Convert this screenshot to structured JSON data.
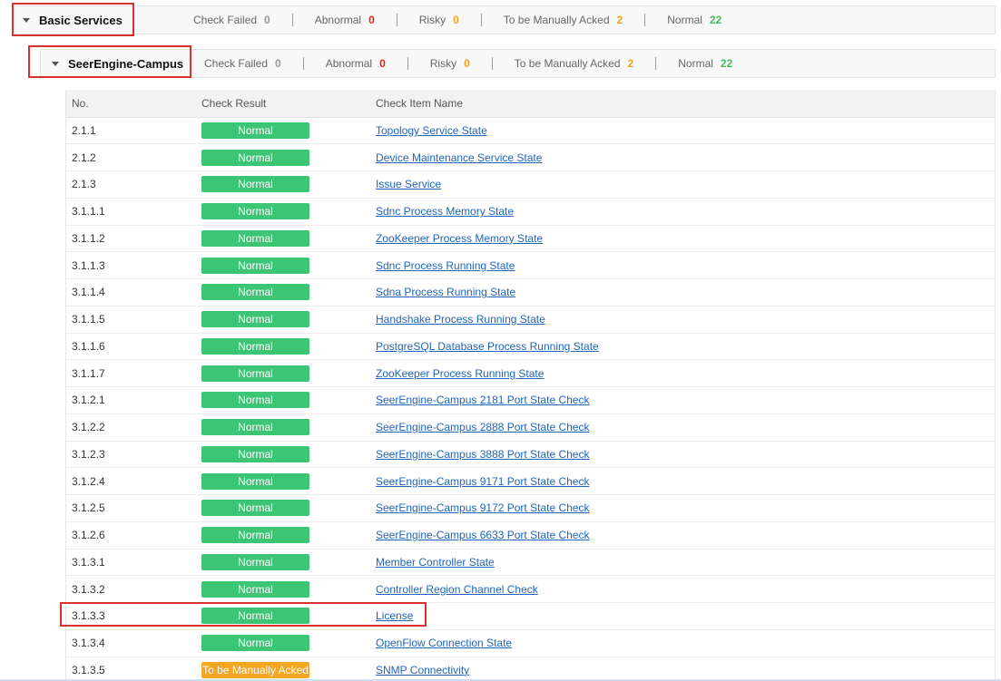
{
  "colors": {
    "normal_badge": "#3cc574",
    "ack_badge": "#f5a623",
    "link": "#2165bb",
    "highlight": "#d9312b",
    "failed": "#999999",
    "abnormal": "#e02020",
    "risky": "#f3a31b",
    "ack": "#f3a31b",
    "normal": "#3fbf5c"
  },
  "icons": {
    "expand": "caret-down-icon"
  },
  "group1": {
    "title": "Basic Services",
    "stats": [
      {
        "label": "Check Failed",
        "value": "0",
        "color": "grey"
      },
      {
        "label": "Abnormal",
        "value": "0",
        "color": "red"
      },
      {
        "label": "Risky",
        "value": "0",
        "color": "orange"
      },
      {
        "label": "To be Manually Acked",
        "value": "2",
        "color": "orange"
      },
      {
        "label": "Normal",
        "value": "22",
        "color": "green"
      }
    ]
  },
  "group2": {
    "title": "SeerEngine-Campus",
    "stats": [
      {
        "label": "Check Failed",
        "value": "0",
        "color": "grey"
      },
      {
        "label": "Abnormal",
        "value": "0",
        "color": "red"
      },
      {
        "label": "Risky",
        "value": "0",
        "color": "orange"
      },
      {
        "label": "To be Manually Acked",
        "value": "2",
        "color": "orange"
      },
      {
        "label": "Normal",
        "value": "22",
        "color": "green"
      }
    ]
  },
  "table": {
    "headers": {
      "no": "No.",
      "result": "Check Result",
      "name": "Check Item Name"
    },
    "rows": [
      {
        "no": "2.1.1",
        "result": "Normal",
        "status": "normal",
        "name": "Topology Service State"
      },
      {
        "no": "2.1.2",
        "result": "Normal",
        "status": "normal",
        "name": "Device Maintenance Service State"
      },
      {
        "no": "2.1.3",
        "result": "Normal",
        "status": "normal",
        "name": "Issue Service"
      },
      {
        "no": "3.1.1.1",
        "result": "Normal",
        "status": "normal",
        "name": "Sdnc Process Memory State"
      },
      {
        "no": "3.1.1.2",
        "result": "Normal",
        "status": "normal",
        "name": "ZooKeeper Process Memory State"
      },
      {
        "no": "3.1.1.3",
        "result": "Normal",
        "status": "normal",
        "name": "Sdnc Process Running State"
      },
      {
        "no": "3.1.1.4",
        "result": "Normal",
        "status": "normal",
        "name": "Sdna Process Running State"
      },
      {
        "no": "3.1.1.5",
        "result": "Normal",
        "status": "normal",
        "name": "Handshake Process Running State"
      },
      {
        "no": "3.1.1.6",
        "result": "Normal",
        "status": "normal",
        "name": "PostgreSQL Database Process Running State"
      },
      {
        "no": "3.1.1.7",
        "result": "Normal",
        "status": "normal",
        "name": "ZooKeeper Process Running State"
      },
      {
        "no": "3.1.2.1",
        "result": "Normal",
        "status": "normal",
        "name": "SeerEngine-Campus 2181 Port State Check"
      },
      {
        "no": "3.1.2.2",
        "result": "Normal",
        "status": "normal",
        "name": "SeerEngine-Campus 2888 Port State Check"
      },
      {
        "no": "3.1.2.3",
        "result": "Normal",
        "status": "normal",
        "name": "SeerEngine-Campus 3888 Port State Check"
      },
      {
        "no": "3.1.2.4",
        "result": "Normal",
        "status": "normal",
        "name": "SeerEngine-Campus 9171 Port State Check"
      },
      {
        "no": "3.1.2.5",
        "result": "Normal",
        "status": "normal",
        "name": "SeerEngine-Campus 9172 Port State Check"
      },
      {
        "no": "3.1.2.6",
        "result": "Normal",
        "status": "normal",
        "name": "SeerEngine-Campus 6633 Port State Check"
      },
      {
        "no": "3.1.3.1",
        "result": "Normal",
        "status": "normal",
        "name": "Member Controller State"
      },
      {
        "no": "3.1.3.2",
        "result": "Normal",
        "status": "normal",
        "name": "Controller Region Channel Check"
      },
      {
        "no": "3.1.3.3",
        "result": "Normal",
        "status": "normal",
        "name": "License"
      },
      {
        "no": "3.1.3.4",
        "result": "Normal",
        "status": "normal",
        "name": "OpenFlow Connection State"
      },
      {
        "no": "3.1.3.5",
        "result": "To be Manually Acked",
        "status": "ack",
        "name": "SNMP Connectivity"
      }
    ]
  }
}
